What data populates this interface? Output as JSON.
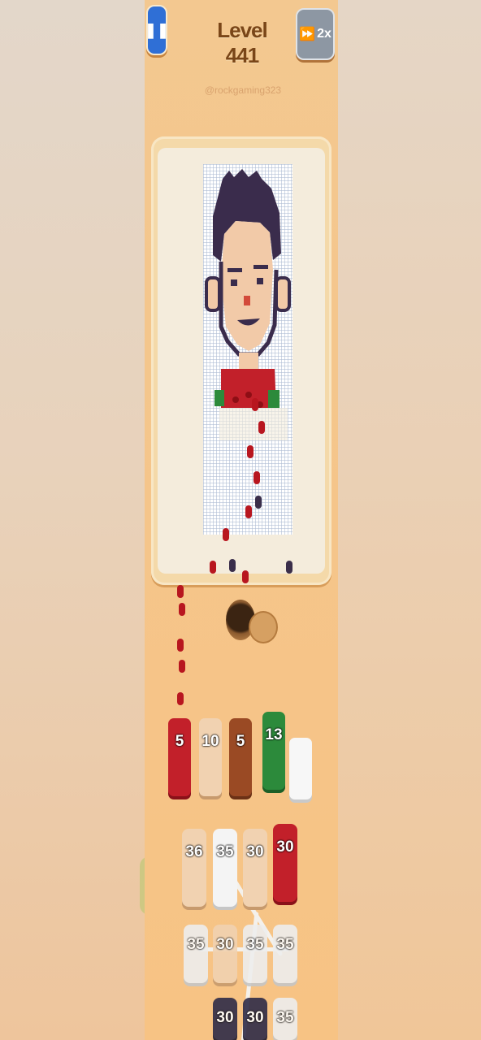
{
  "header": {
    "level_title": "Level 441",
    "speed_label": "2x",
    "username": "@rockgaming323"
  },
  "icons": {
    "pause": "pause-icon",
    "speed": "fast-forward-icon"
  },
  "colors": {
    "red": "#c2202a",
    "peach": "#f1d2b1",
    "brown": "#9a4a24",
    "green": "#2c8a3b",
    "white": "#f7f7f7",
    "dark": "#2f2c48"
  },
  "slots": [
    {
      "value": "5",
      "color": "#c2202a"
    },
    {
      "value": "10",
      "color": "#f1d2b1"
    },
    {
      "value": "5",
      "color": "#9a4a24"
    },
    {
      "value": "13",
      "color": "#2c8a3b"
    },
    {
      "value": "",
      "color": "#f7f7f7"
    }
  ],
  "grid": [
    [
      {
        "value": "36",
        "color": "#f1d2b1"
      },
      {
        "value": "35",
        "color": "#f4f4f4"
      },
      {
        "value": "30",
        "color": "#f1d2b1"
      },
      {
        "value": "30",
        "color": "#c2202a"
      }
    ],
    [
      {
        "value": "35",
        "color": "#eeeeee"
      },
      {
        "value": "30",
        "color": "#f1d2b1"
      },
      {
        "value": "35",
        "color": "#eeeeee"
      },
      {
        "value": "35",
        "color": "#eeeeee"
      }
    ],
    [
      {
        "value": "30",
        "color": "#2f2c48"
      },
      {
        "value": "30",
        "color": "#2f2c48"
      },
      {
        "value": "35",
        "color": "#eeeeee"
      }
    ]
  ]
}
